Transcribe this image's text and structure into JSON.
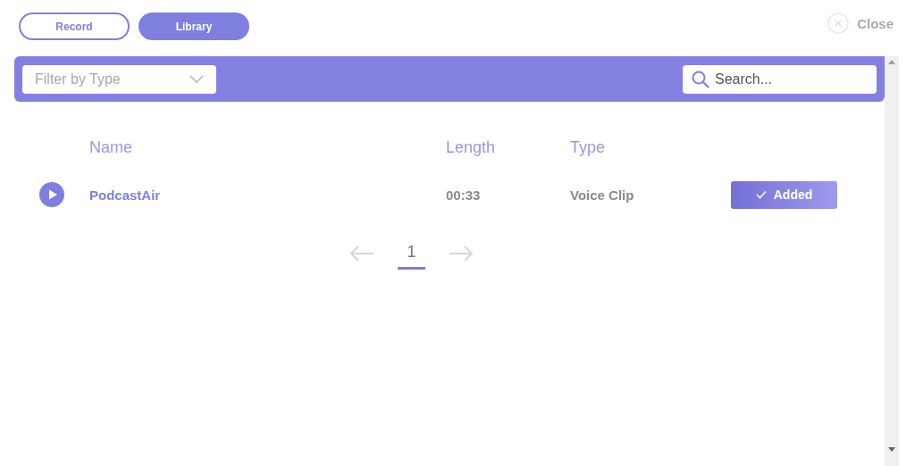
{
  "tabs": [
    {
      "label": "Record",
      "selected": false
    },
    {
      "label": "Library",
      "selected": true
    }
  ],
  "close": {
    "label": "Close"
  },
  "toolbar": {
    "filter": {
      "placeholder": "Filter by Type"
    },
    "search": {
      "placeholder": "Search..."
    }
  },
  "table": {
    "columns": [
      "Name",
      "Length",
      "Type"
    ],
    "rows": [
      {
        "name": "PodcastAir",
        "length": "00:33",
        "type": "Voice Clip",
        "action": {
          "label": "Added",
          "added": true
        }
      }
    ]
  },
  "pagination": {
    "previous": {
      "disabled": true
    },
    "pages": [
      {
        "label": "1",
        "selected": true
      }
    ],
    "next": {
      "disabled": true
    }
  }
}
